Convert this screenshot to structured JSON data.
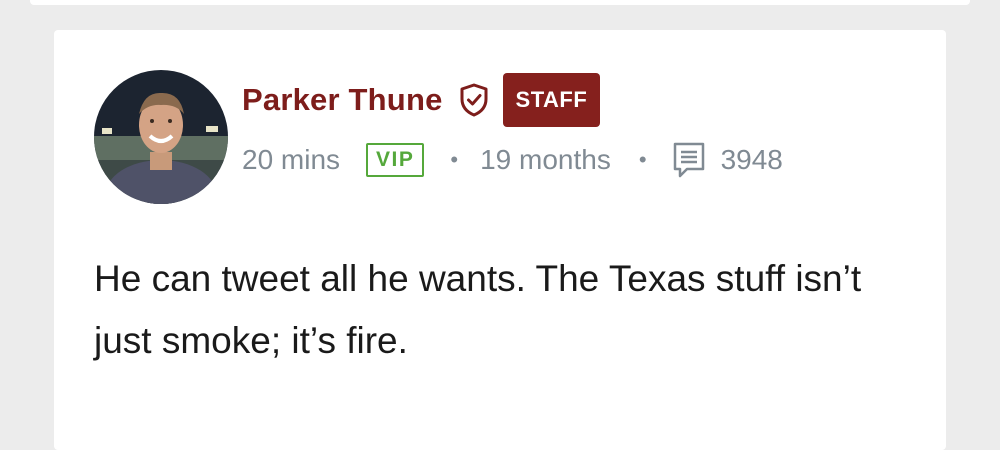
{
  "post": {
    "author": {
      "name": "Parker Thune",
      "badge": "STAFF",
      "verified_icon": "shield-check-icon"
    },
    "meta": {
      "time_ago": "20 mins",
      "tier": "VIP",
      "membership": "19 months",
      "post_count": "3948",
      "post_count_icon": "message-lines-icon"
    },
    "body": "He can tweet all he wants. The Texas stuff isn’t just smoke; it’s fire."
  },
  "colors": {
    "brand": "#85201d",
    "author_name": "#7d1d1b",
    "vip": "#55a83b",
    "meta_text": "#808a93",
    "page_bg": "#ececec"
  }
}
